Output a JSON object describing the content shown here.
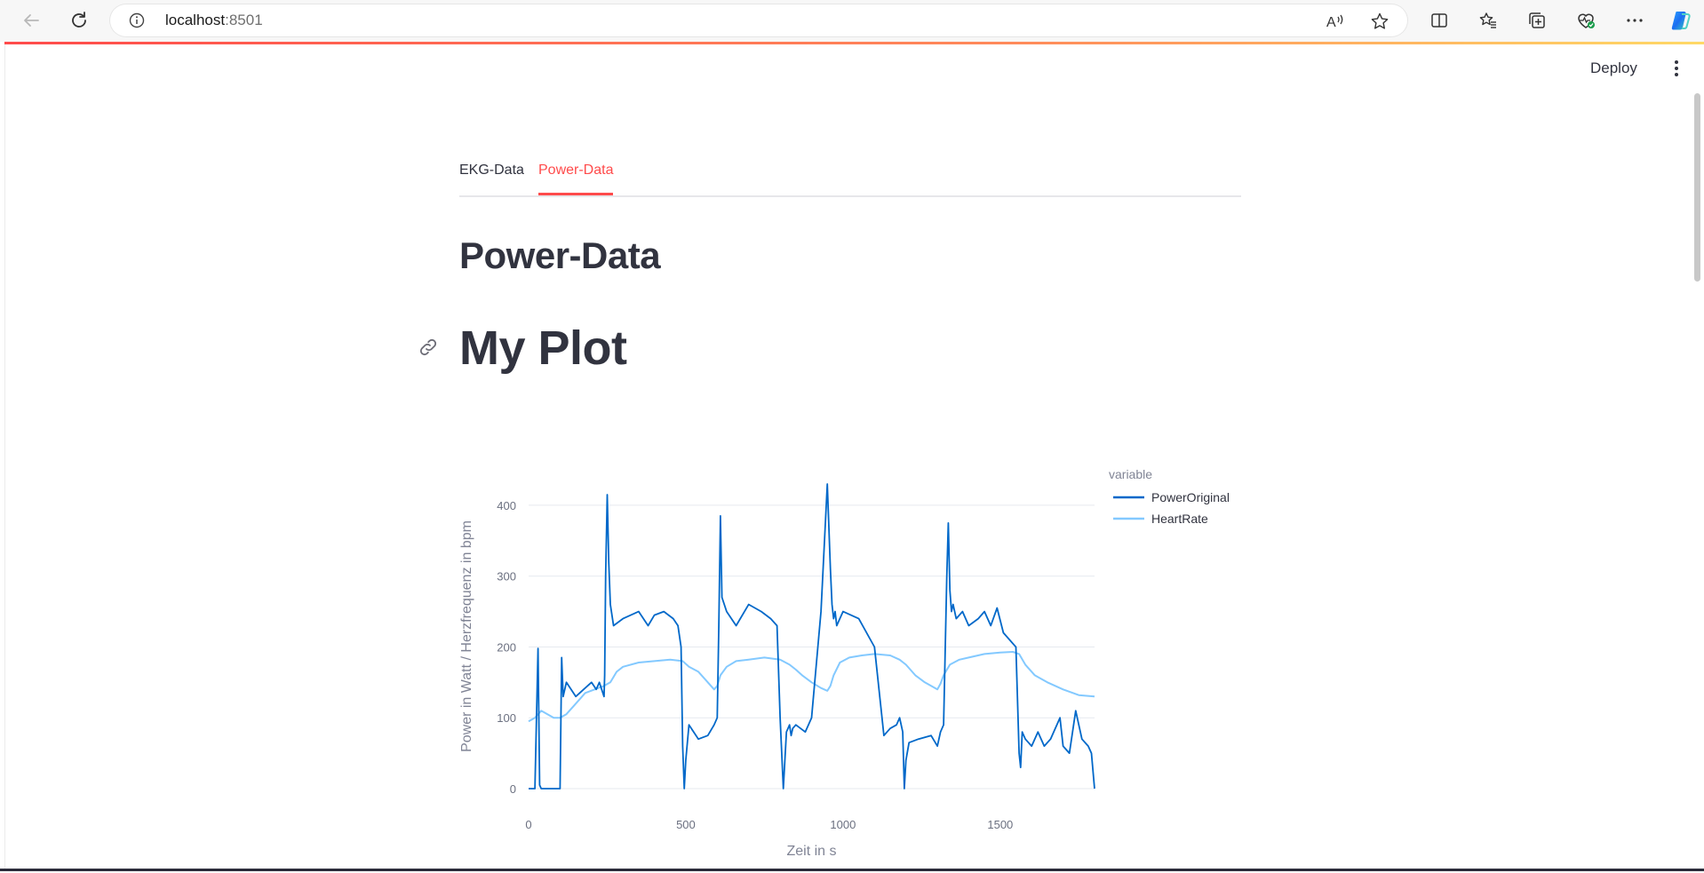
{
  "browser": {
    "url_host": "localhost",
    "url_port": ":8501"
  },
  "app": {
    "deploy_label": "Deploy"
  },
  "tabs": [
    {
      "label": "EKG-Data",
      "active": false
    },
    {
      "label": "Power-Data",
      "active": true
    }
  ],
  "content": {
    "subheader": "Power-Data",
    "title": "My Plot"
  },
  "colors": {
    "accent": "#ff4b4b",
    "power_line": "#0068c9",
    "heart_line": "#83c9ff",
    "text": "#31333f"
  },
  "chart_data": {
    "type": "line",
    "xlabel": "Zeit in s",
    "ylabel": "Power in Watt / Herzfrequenz in bpm",
    "xlim": [
      0,
      1800
    ],
    "ylim": [
      0,
      430
    ],
    "xticks": [
      0,
      500,
      1000,
      1500
    ],
    "yticks": [
      0,
      100,
      200,
      300,
      400
    ],
    "grid": true,
    "legend": {
      "title": "variable",
      "placement": "right"
    },
    "series": [
      {
        "name": "PowerOriginal",
        "color": "#0068c9",
        "x": [
          0,
          20,
          30,
          35,
          40,
          80,
          100,
          105,
          110,
          120,
          150,
          175,
          200,
          215,
          225,
          240,
          242,
          245,
          250,
          255,
          260,
          270,
          300,
          350,
          380,
          400,
          430,
          460,
          475,
          485,
          490,
          495,
          500,
          510,
          540,
          570,
          590,
          600,
          605,
          610,
          615,
          630,
          660,
          700,
          740,
          770,
          790,
          800,
          810,
          820,
          830,
          835,
          840,
          850,
          880,
          900,
          930,
          950,
          960,
          965,
          970,
          975,
          980,
          1000,
          1050,
          1100,
          1130,
          1150,
          1170,
          1180,
          1190,
          1195,
          1200,
          1210,
          1240,
          1280,
          1300,
          1310,
          1320,
          1330,
          1335,
          1340,
          1345,
          1350,
          1360,
          1380,
          1400,
          1430,
          1450,
          1470,
          1490,
          1510,
          1550,
          1560,
          1565,
          1570,
          1580,
          1600,
          1620,
          1640,
          1660,
          1690,
          1700,
          1720,
          1740,
          1760,
          1780,
          1790,
          1800
        ],
        "y": [
          0,
          0,
          198,
          5,
          0,
          0,
          0,
          185,
          130,
          150,
          130,
          140,
          150,
          140,
          150,
          130,
          160,
          300,
          415,
          320,
          260,
          230,
          240,
          250,
          230,
          245,
          250,
          240,
          230,
          200,
          60,
          0,
          40,
          90,
          70,
          75,
          90,
          100,
          230,
          385,
          270,
          250,
          230,
          260,
          250,
          240,
          230,
          100,
          0,
          80,
          90,
          75,
          85,
          90,
          80,
          100,
          250,
          430,
          310,
          260,
          240,
          250,
          230,
          250,
          240,
          200,
          75,
          85,
          90,
          100,
          80,
          0,
          40,
          65,
          70,
          75,
          60,
          80,
          90,
          300,
          375,
          280,
          250,
          260,
          240,
          250,
          230,
          240,
          250,
          230,
          255,
          220,
          200,
          50,
          30,
          80,
          70,
          60,
          80,
          60,
          70,
          100,
          60,
          50,
          110,
          70,
          60,
          50,
          0
        ]
      },
      {
        "name": "HeartRate",
        "color": "#83c9ff",
        "x": [
          0,
          20,
          40,
          60,
          80,
          100,
          120,
          150,
          180,
          210,
          240,
          260,
          280,
          300,
          350,
          400,
          450,
          490,
          510,
          540,
          570,
          590,
          600,
          610,
          630,
          660,
          700,
          750,
          800,
          830,
          850,
          870,
          900,
          930,
          950,
          960,
          970,
          990,
          1020,
          1060,
          1100,
          1150,
          1180,
          1200,
          1230,
          1260,
          1300,
          1310,
          1320,
          1340,
          1370,
          1400,
          1450,
          1500,
          1540,
          1560,
          1580,
          1610,
          1650,
          1700,
          1750,
          1800
        ],
        "y": [
          95,
          100,
          110,
          105,
          100,
          100,
          105,
          120,
          135,
          140,
          145,
          150,
          165,
          172,
          178,
          180,
          182,
          180,
          172,
          165,
          150,
          140,
          145,
          160,
          172,
          180,
          182,
          185,
          182,
          175,
          168,
          160,
          150,
          142,
          138,
          145,
          160,
          178,
          185,
          188,
          190,
          188,
          182,
          175,
          160,
          150,
          140,
          148,
          160,
          175,
          182,
          185,
          190,
          192,
          193,
          190,
          175,
          160,
          150,
          140,
          132,
          130
        ]
      }
    ]
  }
}
